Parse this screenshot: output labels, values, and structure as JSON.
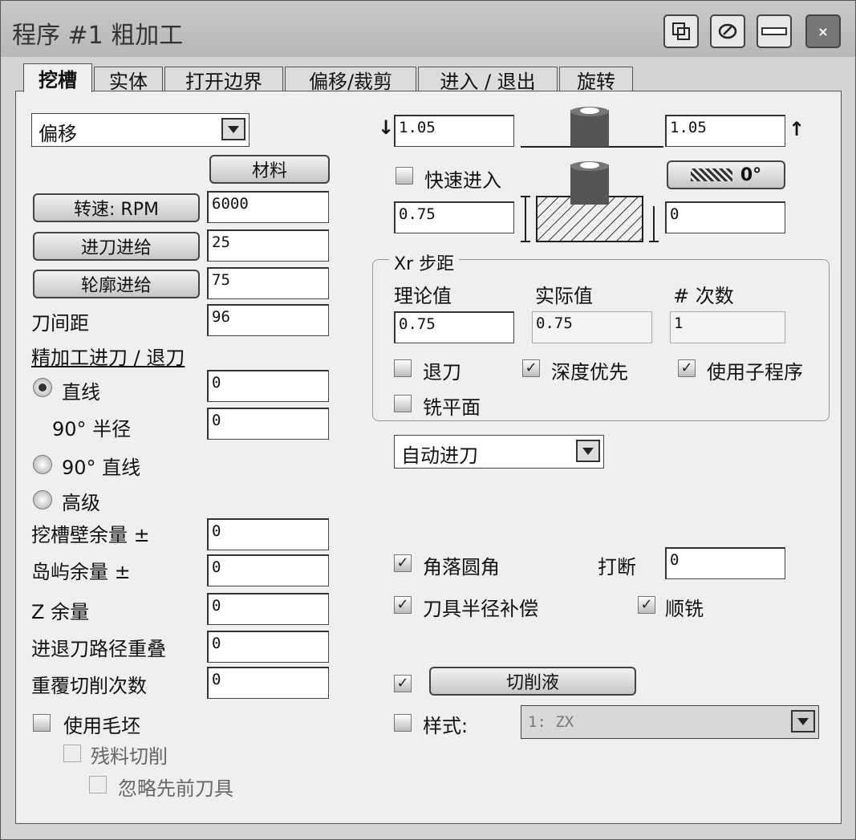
{
  "window": {
    "title": "程序 #1 粗加工"
  },
  "tabs": [
    "挖槽",
    "实体",
    "打开边界",
    "偏移/裁剪",
    "进入 / 退出",
    "旋转"
  ],
  "left": {
    "mode_select": "偏移",
    "material_button": "材料",
    "rpm_button": "转速: RPM",
    "rpm_value": "6000",
    "feed_button": "进刀进给",
    "feed_value": "25",
    "contour_button": "轮廓进给",
    "contour_value": "75",
    "stepover_label": "刀间距",
    "stepover_value": "96",
    "finish_heading": "精加工进刀 / 退刀",
    "radio_line": "直线",
    "radio_line_value": "0",
    "radius_label": "90° 半径",
    "radius_value": "0",
    "radio_90": "90° 直线",
    "radio_adv": "高级",
    "wall_stock_label": "挖槽壁余量 ±",
    "wall_stock_value": "0",
    "island_stock_label": "岛屿余量 ±",
    "island_stock_value": "0",
    "z_stock_label": "Z 余量",
    "z_stock_value": "0",
    "overlap_label": "进退刀路径重叠",
    "overlap_value": "0",
    "repeat_label": "重覆切削次数",
    "repeat_value": "0",
    "use_blank": "使用毛坯",
    "rest_cut": "残料切削",
    "ignore_tool": "忽略先前刀具"
  },
  "right": {
    "top_left_value": "1.05",
    "top_right_value": "1.05",
    "rapid_in": "快速进入",
    "angle_button": "0°",
    "depth_left_value": "0.75",
    "depth_right_value": "0",
    "step_group": "Xr 步距",
    "theory_label": "理论值",
    "actual_label": "实际值",
    "count_label": "# 次数",
    "theory_value": "0.75",
    "actual_value": "0.75",
    "count_value": "1",
    "retract": "退刀",
    "depth_first": "深度优先",
    "use_subprogram": "使用子程序",
    "face_mill": "铣平面",
    "entry_select": "自动进刀",
    "corner_round": "角落圆角",
    "break_label": "打断",
    "break_value": "0",
    "cutter_comp": "刀具半径补偿",
    "climb": "顺铣",
    "coolant_button": "切削液",
    "style_label": "样式:",
    "style_select": "1: ZX"
  }
}
